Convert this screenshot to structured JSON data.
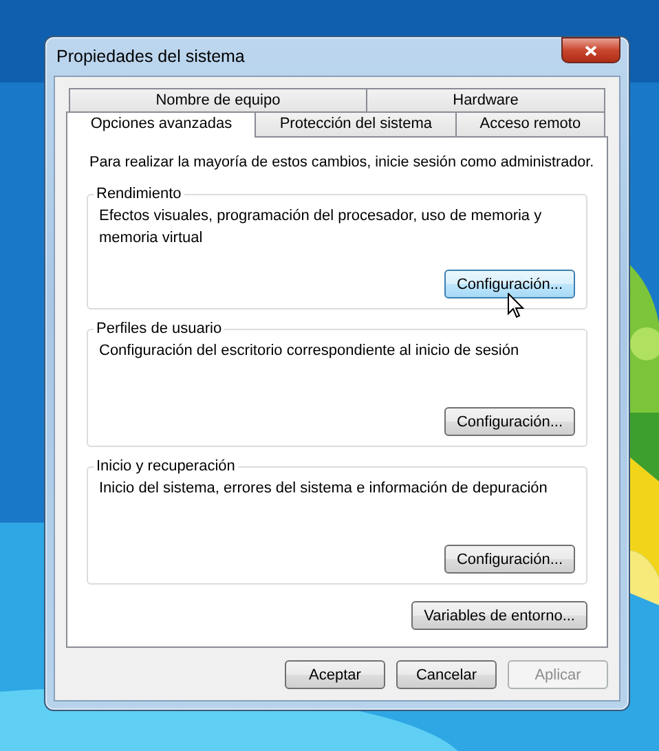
{
  "window": {
    "title": "Propiedades del sistema"
  },
  "tab_rows": [
    [
      {
        "label": "Nombre de equipo",
        "selected": false
      },
      {
        "label": "Hardware",
        "selected": false
      }
    ],
    [
      {
        "label": "Opciones avanzadas",
        "selected": true
      },
      {
        "label": "Protección del sistema",
        "selected": false
      },
      {
        "label": "Acceso remoto",
        "selected": false
      }
    ]
  ],
  "notice": "Para realizar la mayoría de estos cambios, inicie sesión como administrador.",
  "groups": [
    {
      "title": "Rendimiento",
      "description": "Efectos visuales, programación del procesador, uso de memoria y memoria virtual",
      "button": {
        "label": "Configuración...",
        "hovered": true
      }
    },
    {
      "title": "Perfiles de usuario",
      "description": "Configuración del escritorio correspondiente al inicio de sesión",
      "button": {
        "label": "Configuración...",
        "hovered": false
      }
    },
    {
      "title": "Inicio y recuperación",
      "description": "Inicio del sistema, errores del sistema e información de depuración",
      "button": {
        "label": "Configuración...",
        "hovered": false
      }
    }
  ],
  "environment_button": "Variables de entorno...",
  "buttons": [
    {
      "label": "Aceptar",
      "disabled": false
    },
    {
      "label": "Cancelar",
      "disabled": false
    },
    {
      "label": "Aplicar",
      "disabled": true
    }
  ]
}
